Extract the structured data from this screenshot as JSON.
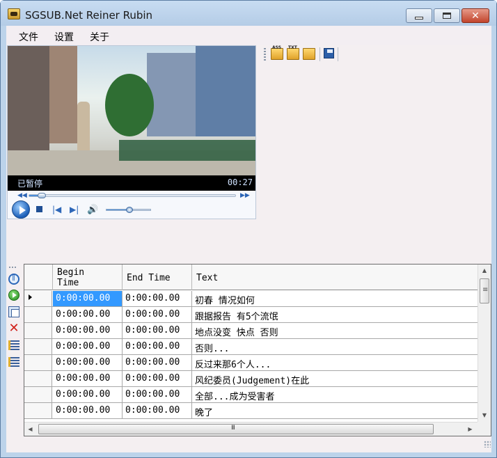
{
  "window": {
    "title": "SGSUB.Net Reiner Rubin"
  },
  "menu": [
    {
      "label": "文件"
    },
    {
      "label": "设置"
    },
    {
      "label": "关于"
    }
  ],
  "player": {
    "status": "已暂停",
    "time": "00:27",
    "seek_fraction": 0.05,
    "volume_fraction": 0.5
  },
  "toolbar": {
    "buttons": [
      {
        "icon": "open-ass-folder-icon",
        "tag": "ASS"
      },
      {
        "icon": "open-txt-folder-icon",
        "tag": "TXT"
      },
      {
        "icon": "open-video-folder-icon",
        "tag": ""
      },
      {
        "icon": "save-floppy-icon",
        "tag": ""
      }
    ]
  },
  "side_toolbar": [
    "pause-icon",
    "play-icon",
    "copy-icon",
    "delete-icon",
    "insert-row-icon",
    "indent-row-icon"
  ],
  "grid": {
    "columns": [
      {
        "label": "Begin Time",
        "lines": [
          "Begin",
          "Time"
        ]
      },
      {
        "label": "End Time"
      },
      {
        "label": "Text"
      }
    ],
    "rows": [
      {
        "begin": "0:00:00.00",
        "end": "0:00:00.00",
        "text": "初春 情况如何",
        "current": true
      },
      {
        "begin": "0:00:00.00",
        "end": "0:00:00.00",
        "text": "跟据报告 有5个流氓"
      },
      {
        "begin": "0:00:00.00",
        "end": "0:00:00.00",
        "text": "地点没变 快点 否则"
      },
      {
        "begin": "0:00:00.00",
        "end": "0:00:00.00",
        "text": "否则..."
      },
      {
        "begin": "0:00:00.00",
        "end": "0:00:00.00",
        "text": "反过来那6个人..."
      },
      {
        "begin": "0:00:00.00",
        "end": "0:00:00.00",
        "text": "风纪委员(Judgement)在此"
      },
      {
        "begin": "0:00:00.00",
        "end": "0:00:00.00",
        "text": "全部...成为受害者"
      },
      {
        "begin": "0:00:00.00",
        "end": "0:00:00.00",
        "text": "晚了"
      }
    ]
  }
}
